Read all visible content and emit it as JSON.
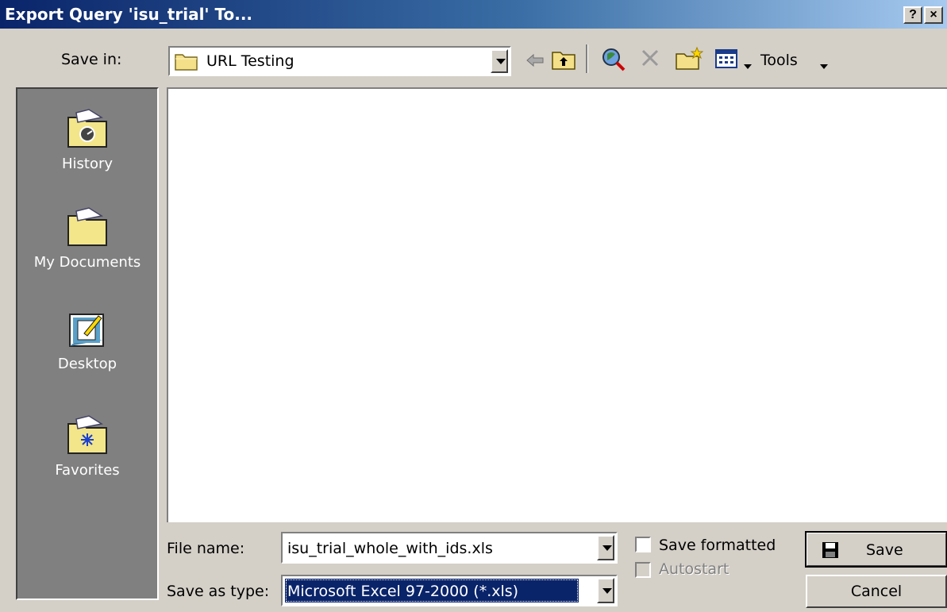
{
  "window": {
    "title": "Export Query 'isu_trial' To...",
    "help_label": "?",
    "close_label": "×"
  },
  "toolbar": {
    "save_in_label": "Save in:",
    "save_in_value": "URL Testing",
    "tools_label": "Tools",
    "icons": [
      "back-arrow-icon",
      "up-folder-icon",
      "search-web-icon",
      "delete-icon",
      "new-folder-icon",
      "views-icon",
      "tools-dropdown-icon"
    ]
  },
  "places": [
    {
      "label": "History",
      "icon": "history-folder-icon"
    },
    {
      "label": "My Documents",
      "icon": "my-documents-folder-icon"
    },
    {
      "label": "Desktop",
      "icon": "desktop-icon"
    },
    {
      "label": "Favorites",
      "icon": "favorites-folder-icon"
    }
  ],
  "form": {
    "file_name_label": "File name:",
    "file_name_value": "isu_trial_whole_with_ids.xls",
    "save_as_type_label": "Save as type:",
    "save_as_type_value": "Microsoft Excel 97-2000 (*.xls)",
    "save_formatted_label": "Save formatted",
    "save_formatted_checked": false,
    "autostart_label": "Autostart",
    "autostart_checked": false
  },
  "buttons": {
    "save": "Save",
    "cancel": "Cancel"
  },
  "colors": {
    "title_start": "#0a246a",
    "title_end": "#a6caf0",
    "face": "#d4d0c8",
    "selection": "#0a246a",
    "places_bg": "#808080"
  }
}
